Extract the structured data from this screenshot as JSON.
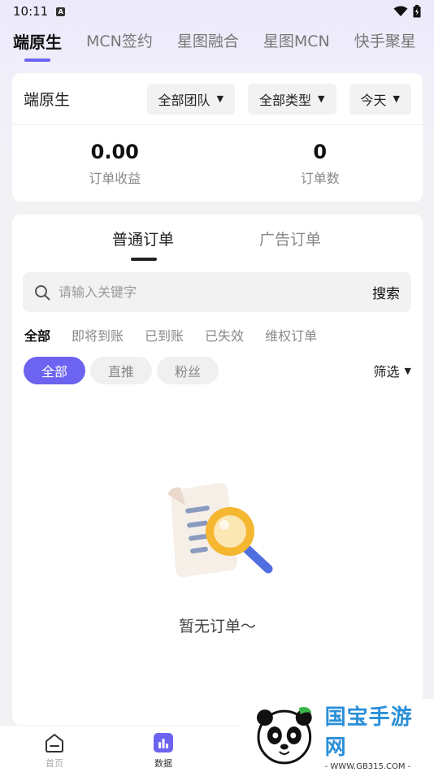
{
  "status_bar": {
    "time": "10:11",
    "notification_letter": "A"
  },
  "top_tabs": [
    "端原生",
    "MCN签约",
    "星图融合",
    "星图MCN",
    "快手聚星"
  ],
  "summary_card": {
    "title": "端原生",
    "dropdowns": [
      "全部团队",
      "全部类型",
      "今天"
    ],
    "stats": [
      {
        "value": "0.00",
        "label": "订单收益"
      },
      {
        "value": "0",
        "label": "订单数"
      }
    ]
  },
  "orders": {
    "tabs": [
      "普通订单",
      "广告订单"
    ],
    "search": {
      "placeholder": "请输入关键字",
      "button": "搜索"
    },
    "status_tabs": [
      "全部",
      "即将到账",
      "已到账",
      "已失效",
      "维权订单"
    ],
    "chips": [
      "全部",
      "直推",
      "粉丝"
    ],
    "filter_label": "筛选",
    "empty_text": "暂无订单～"
  },
  "bottom_nav": [
    {
      "label": "首页",
      "icon": "home-icon"
    },
    {
      "label": "数据",
      "icon": "data-chart-icon"
    }
  ],
  "watermark": {
    "title": "国宝手游网",
    "url": "- WWW.GB315.COM -"
  },
  "colors": {
    "accent": "#6c63f0",
    "watermark_blue": "#2a8fd8"
  }
}
